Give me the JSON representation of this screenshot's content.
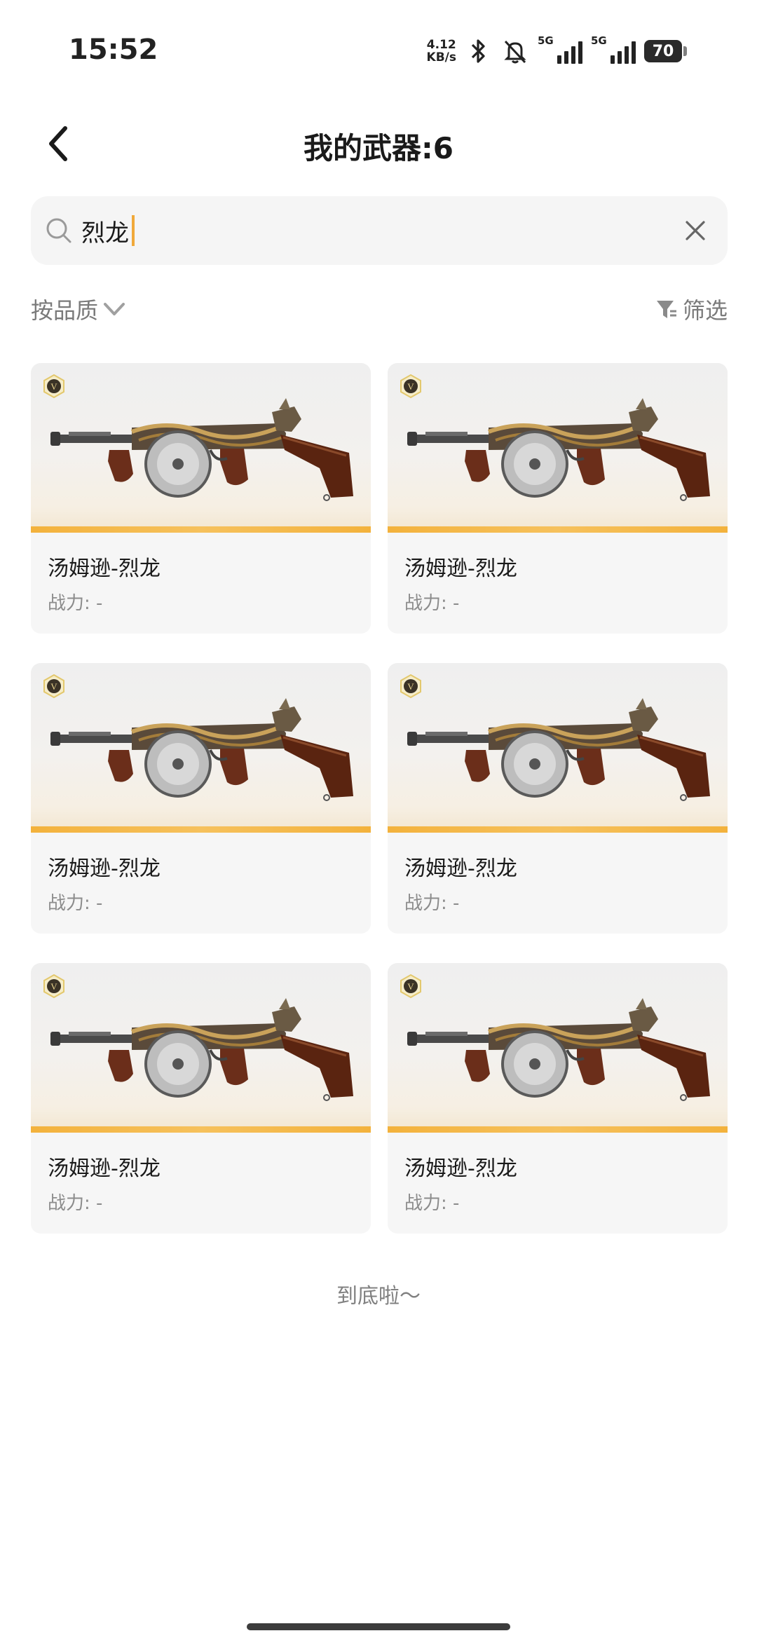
{
  "status_bar": {
    "time": "15:52",
    "net_speed_value": "4.12",
    "net_speed_unit": "KB/s",
    "signal1_label": "5G",
    "signal2_label": "5G",
    "battery": "70",
    "icons": [
      "bluetooth-icon",
      "bell-muted-icon",
      "signal-icon",
      "signal-icon",
      "battery-icon"
    ]
  },
  "header": {
    "title": "我的武器:6",
    "back_icon": "chevron-left-icon"
  },
  "search": {
    "value": "烈龙",
    "icon": "search-icon",
    "clear_icon": "close-icon"
  },
  "toolbar": {
    "sort_label": "按品质",
    "sort_icon": "chevron-down-icon",
    "filter_label": "筛选",
    "filter_icon": "funnel-icon"
  },
  "weapons": [
    {
      "name": "汤姆逊-烈龙",
      "power": "战力: -",
      "badge": "V"
    },
    {
      "name": "汤姆逊-烈龙",
      "power": "战力: -",
      "badge": "V"
    },
    {
      "name": "汤姆逊-烈龙",
      "power": "战力: -",
      "badge": "V"
    },
    {
      "name": "汤姆逊-烈龙",
      "power": "战力: -",
      "badge": "V"
    },
    {
      "name": "汤姆逊-烈龙",
      "power": "战力: -",
      "badge": "V"
    },
    {
      "name": "汤姆逊-烈龙",
      "power": "战力: -",
      "badge": "V"
    }
  ],
  "footer": {
    "end_text": "到底啦～"
  },
  "colors": {
    "accent": "#f3b23c",
    "card_bg": "#f6f6f6",
    "muted_text": "#8c8c8c"
  }
}
